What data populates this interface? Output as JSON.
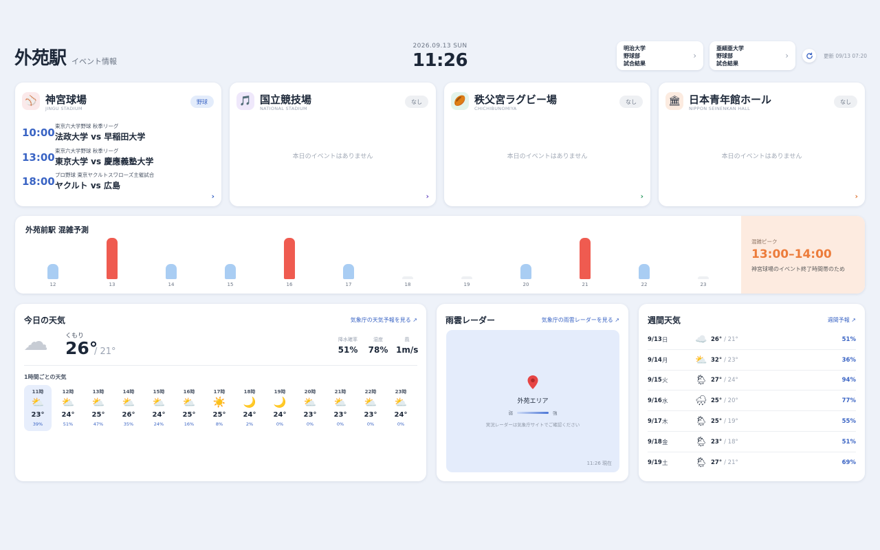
{
  "header": {
    "station": "外苑駅",
    "subtitle": "イベント情報",
    "date": "2026.09.13 SUN",
    "time": "11:26",
    "results": [
      {
        "lines": [
          "明治大学",
          "野球部",
          "試合結果"
        ]
      },
      {
        "lines": [
          "亜細亜大学",
          "野球部",
          "試合結果"
        ]
      }
    ],
    "arrow": "›",
    "refresh_icon": "refresh-icon",
    "updated": "更新 09/13 07:20"
  },
  "venues": [
    {
      "name": "神宮球場",
      "en": "JINGU STADIUM",
      "badge": "野球",
      "badge_active": true,
      "icon": "⚾",
      "icon_bg": "#fbe9ea",
      "arrow": "›",
      "arrow_color": "#3a64c4",
      "events": [
        {
          "time": "10:00",
          "league": "東京六大学野球 秋季リーグ",
          "match": "法政大学 vs 早稲田大学"
        },
        {
          "time": "13:00",
          "league": "東京六大学野球 秋季リーグ",
          "match": "東京大学 vs 慶應義塾大学"
        },
        {
          "time": "18:00",
          "league": "プロ野球 東京ヤクルトスワローズ主催試合",
          "match": "ヤクルト vs 広島"
        }
      ]
    },
    {
      "name": "国立競技場",
      "en": "NATIONAL STADIUM",
      "badge": "なし",
      "badge_active": false,
      "icon": "🎵",
      "icon_bg": "#efe8fb",
      "empty": "本日のイベントはありません",
      "arrow": "›",
      "arrow_color": "#6b4fc4"
    },
    {
      "name": "秩父宮ラグビー場",
      "en": "CHICHIBUNOMIYA",
      "badge": "なし",
      "badge_active": false,
      "icon": "🏉",
      "icon_bg": "#e3f4ec",
      "empty": "本日のイベントはありません",
      "arrow": "›",
      "arrow_color": "#2e9b62"
    },
    {
      "name": "日本青年館ホール",
      "en": "NIPPON SEINENKAN HALL",
      "badge": "なし",
      "badge_active": false,
      "icon": "🏛",
      "icon_bg": "#fcebe0",
      "empty": "本日のイベントはありません",
      "arrow": "›",
      "arrow_color": "#e0783a"
    }
  ],
  "congestion": {
    "title": "外苑前駅 混雑予測",
    "peak_label": "混雑ピーク",
    "peak_time": "13:00–14:00",
    "peak_note": "神宮球場のイベント終了時間帯のため",
    "colors": {
      "high": "#ef5b50",
      "mid": "#a9cdf3",
      "low": "#eef0f3"
    },
    "chart_data": {
      "type": "bar",
      "categories": [
        "12",
        "13",
        "14",
        "15",
        "16",
        "17",
        "18",
        "19",
        "20",
        "21",
        "22",
        "23"
      ],
      "values": [
        3,
        8,
        3,
        3,
        8,
        3,
        0.5,
        0.5,
        3,
        8,
        3,
        0.5
      ],
      "levels": [
        "mid",
        "high",
        "mid",
        "mid",
        "high",
        "mid",
        "low",
        "low",
        "mid",
        "high",
        "mid",
        "low"
      ]
    }
  },
  "today": {
    "title": "今日の天気",
    "link": "気象庁の天気予報を見る ↗",
    "icon": "cloud-icon",
    "condition": "くもり",
    "temp": "26°",
    "low": "/ 21°",
    "stats": [
      {
        "label": "降水確率",
        "value": "51%"
      },
      {
        "label": "湿度",
        "value": "78%"
      },
      {
        "label": "風",
        "value": "1m/s"
      }
    ],
    "hourly_title": "1時間ごとの天気",
    "hourly": [
      {
        "time": "11時",
        "icon": "⛅",
        "temp": "23°",
        "rain": "39%",
        "now": true
      },
      {
        "time": "12時",
        "icon": "⛅",
        "temp": "24°",
        "rain": "51%"
      },
      {
        "time": "13時",
        "icon": "⛅",
        "temp": "25°",
        "rain": "47%"
      },
      {
        "time": "14時",
        "icon": "⛅",
        "temp": "26°",
        "rain": "35%"
      },
      {
        "time": "15時",
        "icon": "⛅",
        "temp": "24°",
        "rain": "24%"
      },
      {
        "time": "16時",
        "icon": "⛅",
        "temp": "25°",
        "rain": "16%"
      },
      {
        "time": "17時",
        "icon": "☀️",
        "temp": "25°",
        "rain": "8%"
      },
      {
        "time": "18時",
        "icon": "🌙",
        "temp": "24°",
        "rain": "2%"
      },
      {
        "time": "19時",
        "icon": "🌙",
        "temp": "24°",
        "rain": "0%"
      },
      {
        "time": "20時",
        "icon": "⛅",
        "temp": "23°",
        "rain": "0%"
      },
      {
        "time": "21時",
        "icon": "⛅",
        "temp": "23°",
        "rain": "0%"
      },
      {
        "time": "22時",
        "icon": "⛅",
        "temp": "23°",
        "rain": "0%"
      },
      {
        "time": "23時",
        "icon": "⛅",
        "temp": "24°",
        "rain": "0%"
      }
    ]
  },
  "radar": {
    "title": "雨雲レーダー",
    "link": "気象庁の雨雲レーダーを見る ↗",
    "pin_icon": "pin-icon",
    "area": "外苑エリア",
    "weak": "弱",
    "strong": "強",
    "note": "実況レーダーは気象庁サイトでご確認ください",
    "time": "11:26 現在"
  },
  "weekly": {
    "title": "週間天気",
    "link": "週間予報 ↗",
    "days": [
      {
        "date": "9/13",
        "dow": "日",
        "icon": "☁️",
        "hi": "26°",
        "lo": "/ 21°",
        "rain": "51%"
      },
      {
        "date": "9/14",
        "dow": "月",
        "icon": "⛅",
        "hi": "32°",
        "lo": "/ 23°",
        "rain": "36%"
      },
      {
        "date": "9/15",
        "dow": "火",
        "icon": "🌦",
        "hi": "27°",
        "lo": "/ 24°",
        "rain": "94%"
      },
      {
        "date": "9/16",
        "dow": "水",
        "icon": "🌧",
        "hi": "25°",
        "lo": "/ 20°",
        "rain": "77%"
      },
      {
        "date": "9/17",
        "dow": "木",
        "icon": "🌦",
        "hi": "25°",
        "lo": "/ 19°",
        "rain": "55%"
      },
      {
        "date": "9/18",
        "dow": "金",
        "icon": "🌦",
        "hi": "23°",
        "lo": "/ 18°",
        "rain": "51%"
      },
      {
        "date": "9/19",
        "dow": "土",
        "icon": "🌦",
        "hi": "27°",
        "lo": "/ 21°",
        "rain": "69%"
      }
    ]
  }
}
